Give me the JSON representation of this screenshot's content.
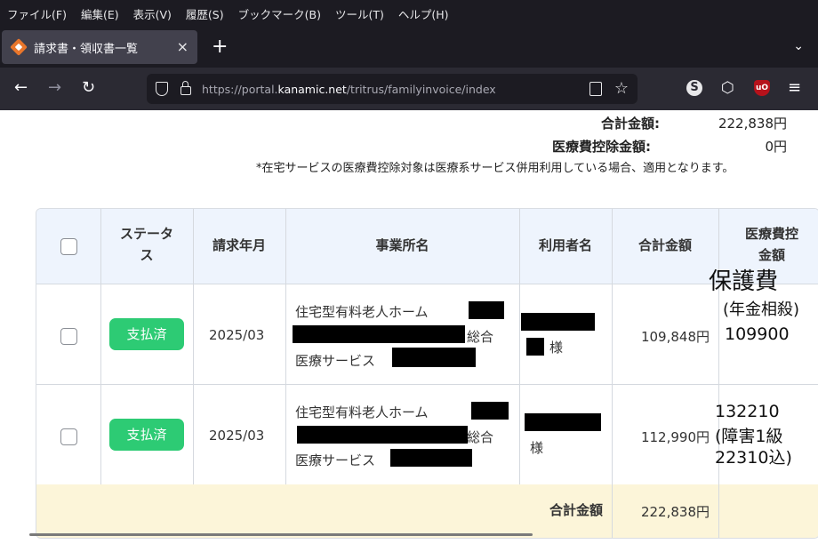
{
  "browser": {
    "menu": [
      "ファイル(F)",
      "編集(E)",
      "表示(V)",
      "履歴(S)",
      "ブックマーク(B)",
      "ツール(T)",
      "ヘルプ(H)"
    ],
    "tab_title": "請求書・領収書一覧",
    "tab_close": "×",
    "new_tab": "+",
    "url_prefix": "https://portal.",
    "url_domain": "kanamic.net",
    "url_path": "/tritrus/familyinvoice/index",
    "icons": [
      "back-icon",
      "forward-icon",
      "reload-icon",
      "shield-icon",
      "lock-icon",
      "reader-view-icon",
      "bookmark-star-icon",
      "extension-s-icon",
      "extensions-icon",
      "ublock-icon",
      "hamburger-menu-icon"
    ]
  },
  "summary": {
    "total_label": "合計金額:",
    "total_value": "222,838円",
    "medical_label": "医療費控除金額:",
    "medical_value": "0円",
    "note": "*在宅サービスの医療費控除対象は医療系サービス併用利用している場合、適用となります。"
  },
  "table": {
    "headers": {
      "status_line1": "ステータ",
      "status_line2": "ス",
      "billing_month": "請求年月",
      "office": "事業所名",
      "user": "利用者名",
      "total": "合計金額",
      "medical_line1": "医療費控",
      "medical_line2": "金額"
    },
    "rows": [
      {
        "status": "支払済",
        "month": "2025/03",
        "office_line1": "住宅型有料老人ホーム",
        "office_line2": "総合",
        "office_line3": "医療サービス",
        "user_suffix": "様",
        "total": "109,848円"
      },
      {
        "status": "支払済",
        "month": "2025/03",
        "office_line1": "住宅型有料老人ホーム",
        "office_line2": "総合",
        "office_line3": "医療サービス",
        "user_suffix": "様",
        "total": "112,990円"
      }
    ],
    "footer_label": "合計金額",
    "footer_total": "222,838円"
  },
  "annotations": {
    "a1": "保護費",
    "a2": "(年金相殺)",
    "a3": "109900",
    "b1": "132210",
    "b2": "(障害1級",
    "b3": "22310込)"
  },
  "colors": {
    "status_badge": "#2dcb74",
    "header_bg": "#eef4fd",
    "footer_bg": "#fcf5d9"
  }
}
